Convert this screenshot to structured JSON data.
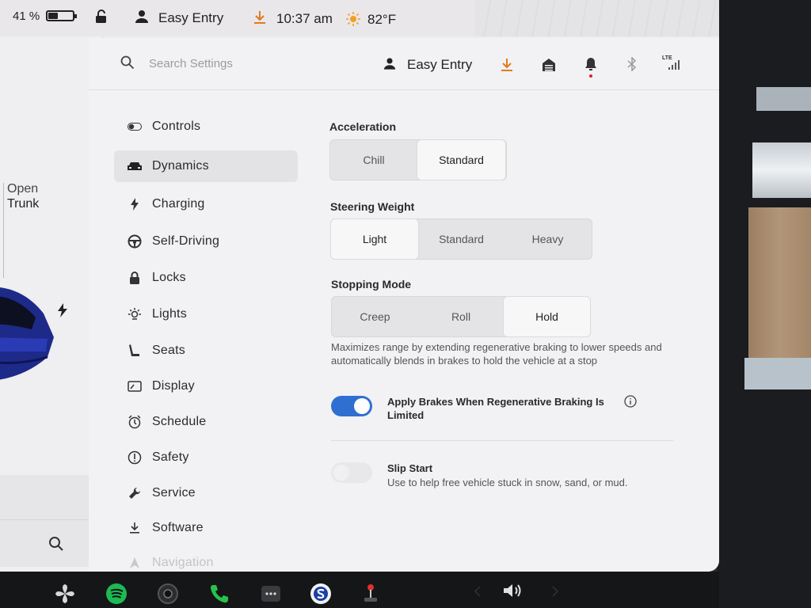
{
  "status_bar": {
    "battery_percent": "41 %",
    "battery_level": 0.41,
    "profile": "Easy Entry",
    "time": "10:37 am",
    "temperature": "82°F"
  },
  "car_panel": {
    "trunk_action": "Open",
    "trunk_label": "Trunk"
  },
  "header": {
    "search_placeholder": "Search Settings",
    "profile": "Easy Entry",
    "signal": "LTE"
  },
  "nav": {
    "items": [
      {
        "label": "Controls",
        "icon": "toggle-icon"
      },
      {
        "label": "Dynamics",
        "icon": "car-icon",
        "active": true
      },
      {
        "label": "Charging",
        "icon": "bolt-icon"
      },
      {
        "label": "Self-Driving",
        "icon": "steering-wheel-icon"
      },
      {
        "label": "Locks",
        "icon": "lock-icon"
      },
      {
        "label": "Lights",
        "icon": "light-icon"
      },
      {
        "label": "Seats",
        "icon": "seat-icon"
      },
      {
        "label": "Display",
        "icon": "display-icon"
      },
      {
        "label": "Schedule",
        "icon": "schedule-icon"
      },
      {
        "label": "Safety",
        "icon": "safety-icon"
      },
      {
        "label": "Service",
        "icon": "wrench-icon"
      },
      {
        "label": "Software",
        "icon": "download-icon"
      },
      {
        "label": "Navigation",
        "icon": "navigation-icon"
      }
    ]
  },
  "dynamics": {
    "acceleration": {
      "title": "Acceleration",
      "options": [
        "Chill",
        "Standard"
      ],
      "selected": "Standard"
    },
    "steering_weight": {
      "title": "Steering Weight",
      "options": [
        "Light",
        "Standard",
        "Heavy"
      ],
      "selected": "Light"
    },
    "stopping_mode": {
      "title": "Stopping Mode",
      "options": [
        "Creep",
        "Roll",
        "Hold"
      ],
      "selected": "Hold",
      "description": "Maximizes range by extending regenerative braking to lower speeds and automatically blends in brakes to hold the vehicle at a stop"
    },
    "apply_brakes": {
      "title_line1": "Apply Brakes When Regenerative Braking Is",
      "title_line2": "Limited",
      "enabled": true
    },
    "slip_start": {
      "title": "Slip Start",
      "subtitle": "Use to help free vehicle stuck in snow, sand, or mud.",
      "enabled": false
    }
  },
  "colors": {
    "accent_blue": "#2f6fd1",
    "download_orange": "#e07b1e"
  }
}
